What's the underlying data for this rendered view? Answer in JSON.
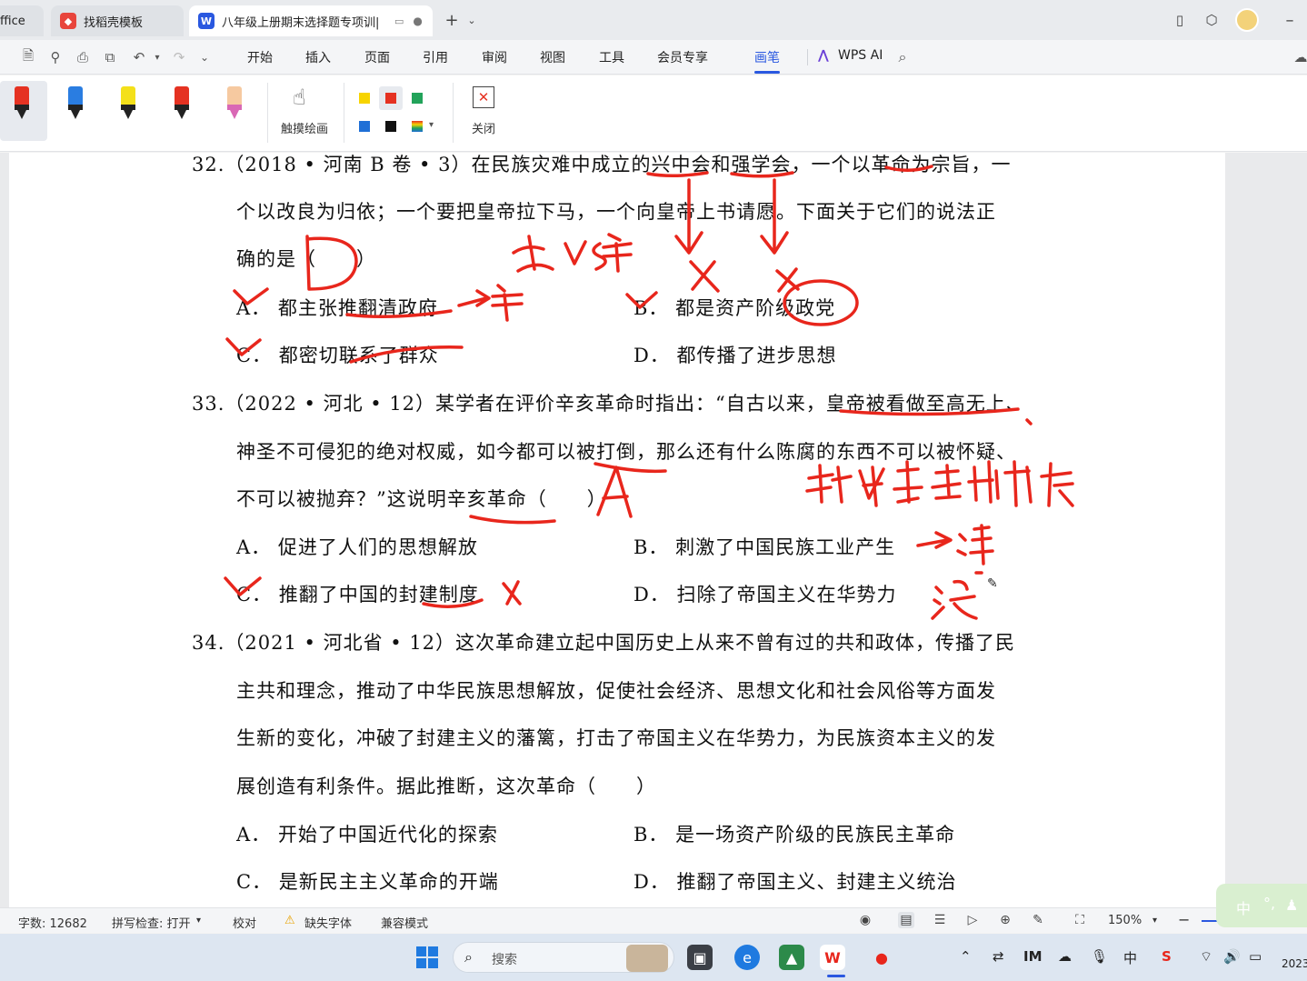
{
  "tabs": [
    {
      "label": "ffice",
      "state": "inactive"
    },
    {
      "label": "找稻壳模板",
      "state": "inactive",
      "icon": "docer-icon"
    },
    {
      "label": "八年级上册期末选择题专项训|",
      "state": "active",
      "icon": "wps-writer-icon"
    }
  ],
  "menubar": {
    "items": [
      "开始",
      "插入",
      "页面",
      "引用",
      "审阅",
      "视图",
      "工具",
      "会员专享",
      "画笔"
    ],
    "selected": "画笔",
    "wps_ai": "WPS AI"
  },
  "ribbon": {
    "pens": [
      {
        "color": "#e53222"
      },
      {
        "color": "#2a7de1"
      },
      {
        "color": "#f4e01a"
      },
      {
        "color": "#e53222"
      },
      {
        "color": "#f6c9a0"
      }
    ],
    "touch_draw_label": "触摸绘画",
    "colors": [
      "#f7d400",
      "#e53222",
      "#22a35a",
      "#1f6fd6",
      "#111111"
    ],
    "close_label": "关闭"
  },
  "document": {
    "q32": {
      "line1": "32.（2018 • 河南 B 卷 • 3）在民族灾难中成立的兴中会和强学会，一个以革命为宗旨，一",
      "line2": "个以改良为归依；一个要把皇帝拉下马，一个向皇帝上书请愿。下面关于它们的说法正",
      "line3": "确的是（　　）",
      "optA": "A．  都主张推翻清政府",
      "optB": "B．  都是资产阶级政党",
      "optC": "C．  都密切联系了群众",
      "optD": "D．  都传播了进步思想"
    },
    "q33": {
      "line1": "33.（2022 • 河北 • 12）某学者在评价辛亥革命时指出：“自古以来，皇帝被看做至高无上、",
      "line2": "神圣不可侵犯的绝对权威，如今都可以被打倒，那么还有什么陈腐的东西不可以被怀疑、",
      "line3": "不可以被抛弃？”这说明辛亥革命（　　）",
      "optA": "A．  促进了人们的思想解放",
      "optB": "B．  刺激了中国民族工业产生",
      "optC": "C．  推翻了中国的封建制度",
      "optD": "D．  扫除了帝国主义在华势力"
    },
    "q34": {
      "line1": "34.（2021 • 河北省 • 12）这次革命建立起中国历史上从来不曾有过的共和政体，传播了民",
      "line2": "主共和理念，推动了中华民族思想解放，促使社会经济、思想文化和社会风俗等方面发",
      "line3": "生新的变化，冲破了封建主义的藩篱，打击了帝国主义在华势力，为民族资本主义的发",
      "line4": "展创造有利条件。据此推断，这次革命（　　）",
      "optA": "A．  开始了中国近代化的探索",
      "optB": "B．  是一场资产阶级的民族民主革命",
      "optC": "C．  是新民主主义革命的开端",
      "optD": "D．  推翻了帝国主义、封建主义统治"
    },
    "handwriting_ink": "#e8261c"
  },
  "statusbar": {
    "word_count": "字数: 12682",
    "spellcheck": "拼写检查: 打开",
    "proofread": "校对",
    "missing_font": "缺失字体",
    "compat_mode": "兼容模式",
    "zoom": "150%"
  },
  "ime": {
    "label": "中"
  },
  "taskbar": {
    "search_placeholder": "搜索",
    "tray_ime": "中",
    "clock_partial": "2023"
  }
}
